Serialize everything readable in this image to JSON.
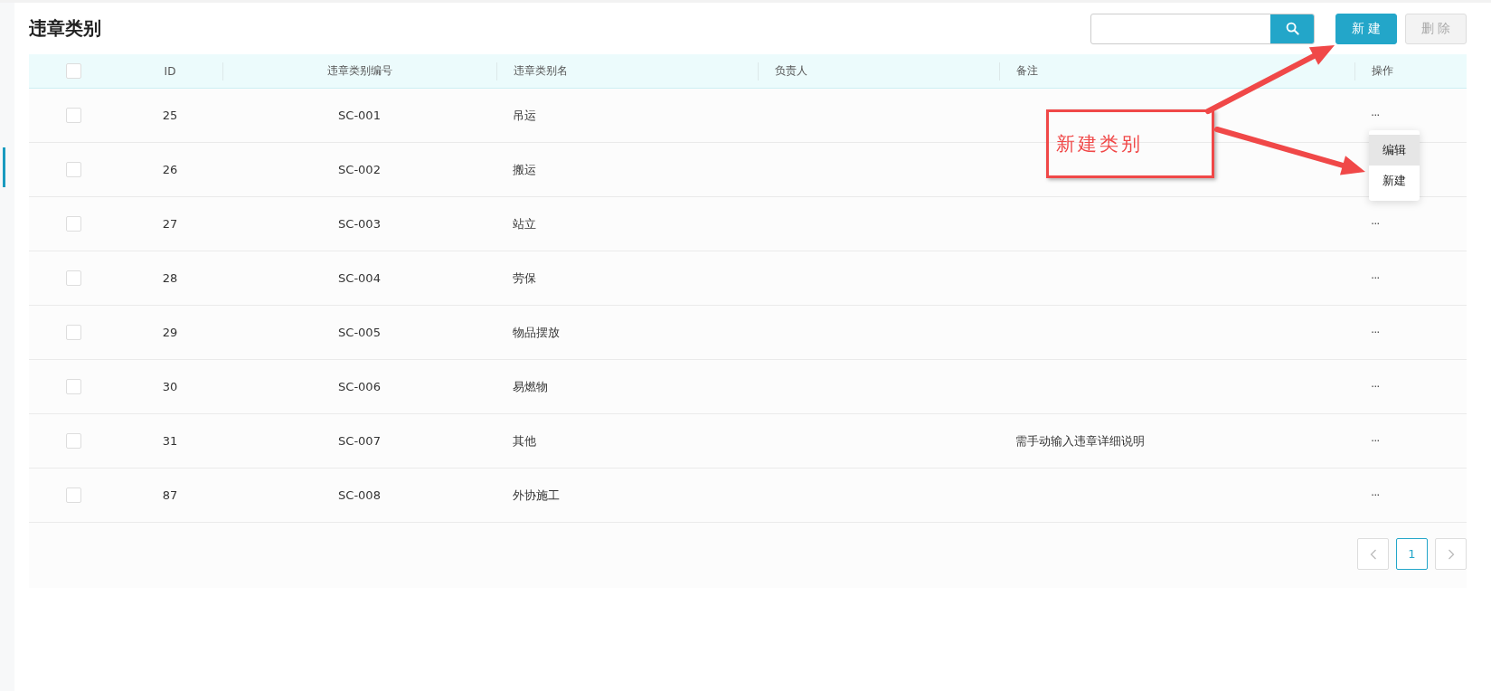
{
  "title": "违章类别",
  "toolbar": {
    "create_button": {
      "label": "新 建",
      "disabled": false
    },
    "delete_button": {
      "label": "删 除",
      "disabled": true
    }
  },
  "table": {
    "select_all_checked": false,
    "columns": [
      "ID",
      "违章类别编号",
      "违章类别名",
      "负责人",
      "备注",
      "操作"
    ],
    "rows": [
      {
        "checked": false,
        "id": "25",
        "code": "SC-001",
        "name": "吊运",
        "action": "···"
      },
      {
        "checked": false,
        "id": "26",
        "code": "SC-002",
        "name": "搬运"
      },
      {
        "checked": false,
        "id": "27",
        "code": "SC-003",
        "name": "站立",
        "action": "···"
      },
      {
        "checked": false,
        "id": "28",
        "code": "SC-004",
        "name": "劳保",
        "action": "···"
      },
      {
        "checked": false,
        "id": "29",
        "code": "SC-005",
        "name": "物品摆放",
        "action": "···"
      },
      {
        "checked": false,
        "id": "30",
        "code": "SC-006",
        "name": "易燃物",
        "action": "···"
      },
      {
        "checked": false,
        "id": "31",
        "code": "SC-007",
        "name": "其他",
        "remark": "需手动输入违章详细说明",
        "action": "···"
      },
      {
        "checked": false,
        "id": "87",
        "code": "SC-008",
        "name": "外协施工",
        "action": "···"
      }
    ]
  },
  "row_menu": {
    "open": true,
    "items": [
      {
        "label": "编辑",
        "highlighted": true
      },
      {
        "label": "新建",
        "highlighted": false
      }
    ]
  },
  "pagination": {
    "pages": [
      {
        "label": "1",
        "selected": true
      }
    ]
  },
  "annotation": {
    "text": "新建类别"
  }
}
